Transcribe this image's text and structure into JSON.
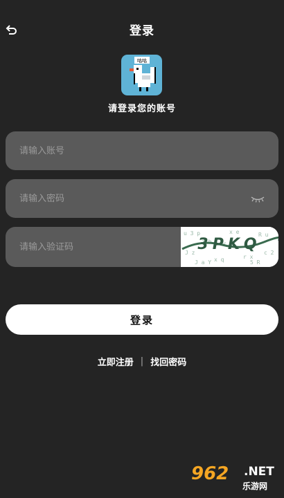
{
  "header": {
    "title": "登录",
    "back_icon": "undo-arrow-icon"
  },
  "logo": {
    "badge_text": "咕咕",
    "icon": "pixel-pigeon-icon",
    "bg_color": "#5fb3d6"
  },
  "subtitle": "请登录您的账号",
  "form": {
    "account_placeholder": "请输入账号",
    "password_placeholder": "请输入密码",
    "password_toggle_icon": "eye-closed-icon",
    "captcha_placeholder": "请输入验证码",
    "captcha_text": "3PKQ"
  },
  "login_button": "登录",
  "links": {
    "register": "立即注册",
    "separator": "|",
    "forgot": "找回密码"
  },
  "watermark": {
    "number": "962",
    "suffix": ".NET",
    "subtitle": "乐游网"
  },
  "colors": {
    "background": "#242424",
    "field": "#5a5a5a",
    "button": "#ffffff",
    "watermark_accent": "#f5a623"
  }
}
